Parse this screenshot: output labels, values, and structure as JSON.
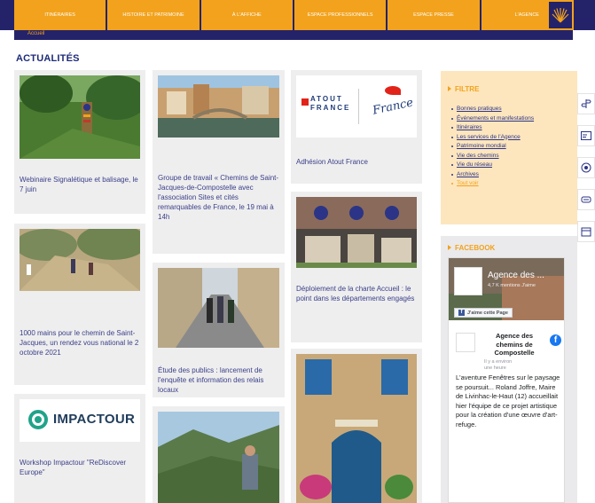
{
  "nav": {
    "items": [
      "ITINÉRAIRES",
      "HISTOIRE ET PATRIMOINE",
      "À L'AFFICHE",
      "ESPACE PROFESSIONNELS",
      "ESPACE PRESSE",
      "L'AGENCE"
    ],
    "logo_icon": "scallop-shell-icon"
  },
  "breadcrumb": "Accueil",
  "section_title": "ACTUALITÉS",
  "cards": {
    "c1": "Webinaire Signalétique et balisage, le 7 juin",
    "c2": "1000 mains pour le chemin de Saint-Jacques, un rendez vous national le 2 octobre 2021",
    "c3": "Workshop Impactour \"ReDiscover Europe\"",
    "c3_logo": "IMPACTOUR",
    "c4": "Groupe de travail « Chemins de Saint-Jacques-de-Compostelle avec l'association Sites et cités remarquables de France, le 19 mai à 14h",
    "c5": "Étude des publics : lancement de l'enquête et information des relais locaux",
    "c7": "Adhésion Atout France",
    "c7_logo_a": "ATOUT",
    "c7_logo_b": "FRANCE",
    "c7_logo_script": "France",
    "c8": "Déploiement de la charte Accueil : le point dans les départements engagés"
  },
  "filtre": {
    "title": "FILTRE",
    "items": [
      "Bonnes pratiques",
      "Événements et manifestations",
      "Itinéraires",
      "Les services de l'Agence",
      "Patrimoine mondial",
      "Vie des chemins",
      "Vie du réseau",
      "Archives",
      "Tout voir"
    ]
  },
  "facebook": {
    "title": "FACEBOOK",
    "page_name": "Agence des ...",
    "follow": "4,7 K mentions J'aime",
    "like_button": "J'aime cette Page",
    "post_title": "Agence des chemins de Compostelle",
    "post_time": "Il y a environ une heure",
    "post_text": "L'aventure Fenêtres sur le paysage se poursuit... Roland Joffre, Maire de Livinhac-le-Haut (12) accueillait hier l'équipe de ce projet artistique pour la création d'une œuvre d'art-refuge."
  },
  "colors": {
    "nav_orange": "#f2a21c",
    "nav_blue": "#24236a",
    "title_blue": "#1e2b78",
    "link_blue": "#2b3486"
  },
  "rail_icons": [
    "signpost-icon",
    "id-card-icon",
    "map-pin-icon",
    "accessibility-icon",
    "calendar-icon"
  ]
}
